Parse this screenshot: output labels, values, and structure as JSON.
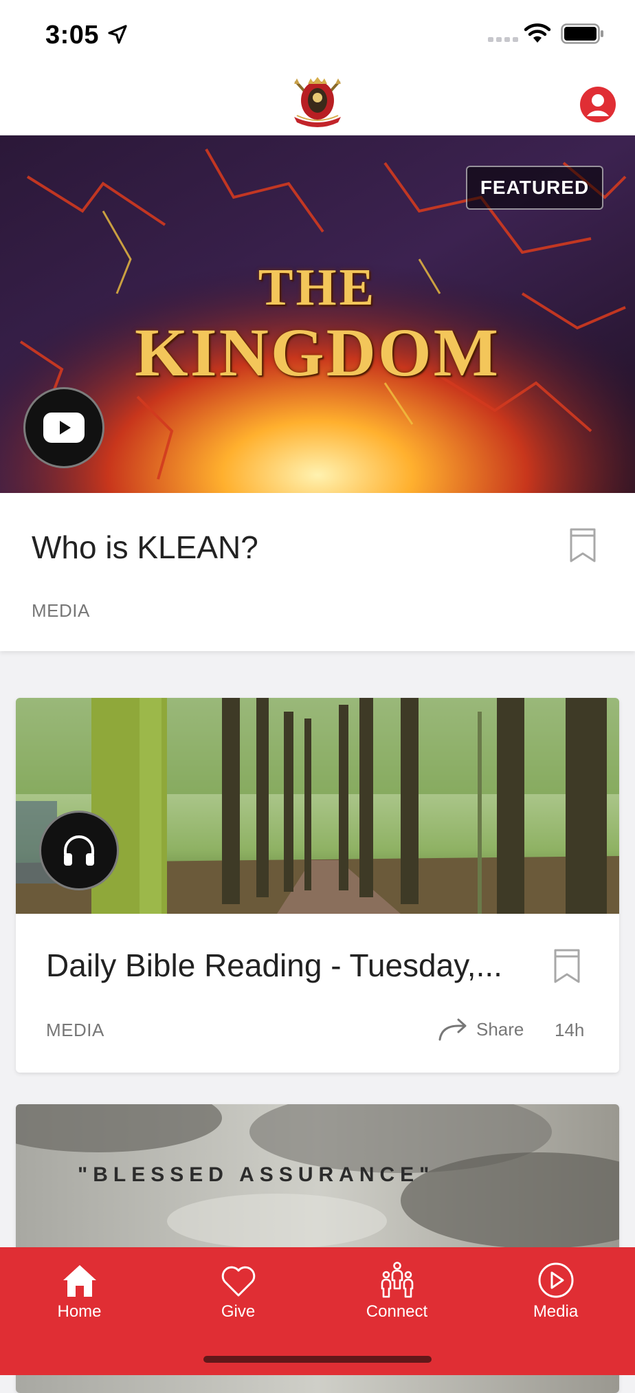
{
  "status_bar": {
    "time": "3:05"
  },
  "featured": {
    "badge": "FEATURED",
    "art_title_line1": "THE",
    "art_title_line2": "KINGDOM",
    "title": "Who is KLEAN?",
    "category": "MEDIA"
  },
  "feed": [
    {
      "title": "Daily Bible Reading - Tuesday,...",
      "category": "MEDIA",
      "share_label": "Share",
      "time_ago": "14h"
    },
    {
      "image_text": "\"BLESSED ASSURANCE\""
    }
  ],
  "tabs": [
    {
      "label": "Home",
      "icon": "home-icon"
    },
    {
      "label": "Give",
      "icon": "heart-icon"
    },
    {
      "label": "Connect",
      "icon": "people-icon"
    },
    {
      "label": "Media",
      "icon": "play-circle-icon"
    }
  ],
  "colors": {
    "accent": "#e02e34"
  }
}
